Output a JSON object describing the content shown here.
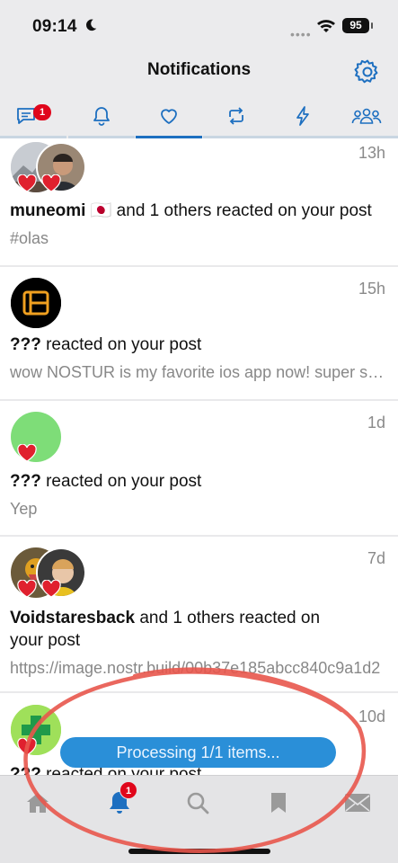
{
  "status_bar": {
    "time": "09:14",
    "battery": "95",
    "dots": "••••"
  },
  "header": {
    "title": "Notifications"
  },
  "tabs": [
    {
      "name": "tab-posts",
      "icon": "message-icon",
      "badge": "1"
    },
    {
      "name": "tab-mentions",
      "icon": "bell-icon"
    },
    {
      "name": "tab-reactions",
      "icon": "heart-icon",
      "active": true
    },
    {
      "name": "tab-reposts",
      "icon": "repost-icon"
    },
    {
      "name": "tab-zaps",
      "icon": "bolt-icon"
    },
    {
      "name": "tab-followers",
      "icon": "people-icon"
    }
  ],
  "notifications": [
    {
      "time": "13h",
      "user": "muneomi",
      "flag": "🇯🇵",
      "action": " and 1 others reacted on your post",
      "preview": "#olas"
    },
    {
      "time": "15h",
      "user": "???",
      "action": " reacted on your post",
      "preview": "wow NOSTUR is my favorite ios app now! super smooth"
    },
    {
      "time": "1d",
      "user": "???",
      "action": " reacted on your post",
      "preview": "Yep"
    },
    {
      "time": "7d",
      "user": "Voidstaresback",
      "action": " and 1 others reacted on your post",
      "preview": "https://image.nostr.build/00b37e185abcc840c9a1d2"
    },
    {
      "time": "10d",
      "user": "???",
      "action": " reacted on your post"
    }
  ],
  "processing": {
    "text": "Processing 1/1 items..."
  },
  "tabbar": {
    "items": [
      "home-icon",
      "bell-icon",
      "search-icon",
      "bookmark-icon",
      "mail-icon"
    ],
    "bell_badge": "1"
  },
  "colors": {
    "accent": "#1d6fc0",
    "badge": "#e0061b",
    "annotation": "#e8574c",
    "pill": "#2a8fd8"
  }
}
